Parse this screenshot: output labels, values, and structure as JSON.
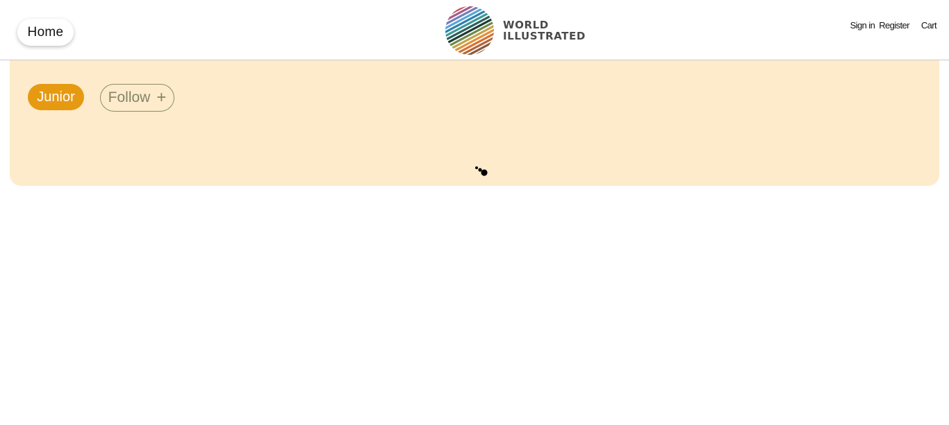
{
  "header": {
    "home_label": "Home",
    "brand": {
      "line1": "WORLD",
      "line2": "ILLUSTRATED"
    },
    "links": {
      "sign_in": "Sign in",
      "register": "Register",
      "cart": "Cart"
    }
  },
  "panel": {
    "badge_label": "Junior",
    "follow_label": "Follow",
    "follow_icon": "+"
  },
  "colors": {
    "panel_bg": "#fdebcb",
    "badge_bg": "#e69a12",
    "follow_text": "#84846a"
  },
  "icons": {
    "logo": "globe-stripes-icon",
    "follow": "plus-icon",
    "loading": "loading-spinner-icon"
  }
}
